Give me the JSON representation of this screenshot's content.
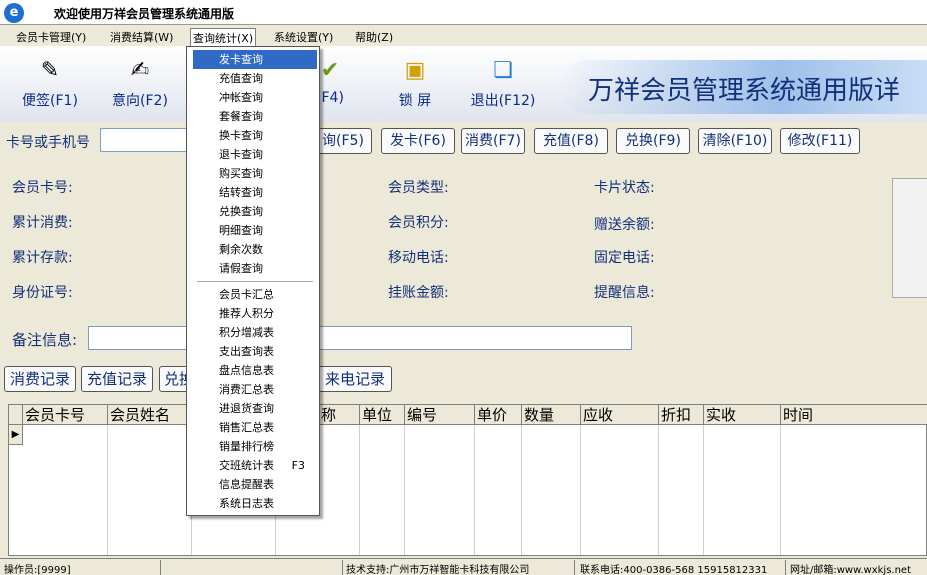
{
  "window": {
    "title": "欢迎使用万祥会员管理系统通用版",
    "icon": "app-logo-icon"
  },
  "menu": [
    {
      "label": "会员卡管理(Y)"
    },
    {
      "label": "消费结算(W)"
    },
    {
      "label": "查询统计(X)"
    },
    {
      "label": "系统设置(Y)"
    },
    {
      "label": "帮助(Z)"
    }
  ],
  "toolbar": {
    "buttons": [
      {
        "label": "便签(F1)",
        "icon": "note-icon"
      },
      {
        "label": "意向(F2)",
        "icon": "intent-icon"
      },
      {
        "label": "(F4)",
        "icon": "book-icon"
      },
      {
        "label": "锁  屏",
        "icon": "lock-screen-icon"
      },
      {
        "label": "退出(F12)",
        "icon": "exit-icon"
      }
    ],
    "banner": "万祥会员管理系统通用版详"
  },
  "search": {
    "label": "卡号或手机号",
    "value": "",
    "buttons": [
      "询(F5)",
      "发卡(F6)",
      "消费(F7)",
      "充值(F8)",
      "兑换(F9)",
      "清除(F10)",
      "修改(F11)"
    ]
  },
  "member_info": {
    "card_no": "会员卡号:",
    "total_spent": "累计消费:",
    "total_deposit": "累计存款:",
    "id_no": "身份证号:",
    "member_type": "会员类型:",
    "points": "会员积分:",
    "mobile": "移动电话:",
    "credit": "挂账金额:",
    "card_status": "卡片状态:",
    "bonus_balance": "赠送余额:",
    "phone": "固定电话:",
    "reminder": "提醒信息:"
  },
  "remark": {
    "label": "备注信息:",
    "value": ""
  },
  "tabs": [
    "消费记录",
    "充值记录",
    "兑换",
    "来电记录"
  ],
  "grid": {
    "columns": [
      "会员卡号",
      "会员姓名",
      "名称",
      "单位",
      "编号",
      "单价",
      "数量",
      "应收",
      "折扣",
      "实收",
      "时间"
    ],
    "row_indicator": "▶"
  },
  "status": {
    "operator": "操作员:[9999]",
    "support": "技术支持:广州市万祥智能卡科技有限公司",
    "contact": "联系电话:400-0386-568 15915812331",
    "website": "网址/邮箱:www.wxkjs.net"
  },
  "query_menu": {
    "items": [
      {
        "label": "发卡查询",
        "highlighted": true
      },
      {
        "label": "充值查询"
      },
      {
        "label": "冲帐查询"
      },
      {
        "label": "套餐查询"
      },
      {
        "label": "换卡查询"
      },
      {
        "label": "退卡查询"
      },
      {
        "label": "购买查询"
      },
      {
        "label": "结转查询"
      },
      {
        "label": "兑换查询"
      },
      {
        "label": "明细查询"
      },
      {
        "label": "剩余次数"
      },
      {
        "label": "请假查询"
      }
    ],
    "items2": [
      {
        "label": "会员卡汇总"
      },
      {
        "label": "推荐人积分"
      },
      {
        "label": "积分增减表"
      },
      {
        "label": "支出查询表"
      },
      {
        "label": "盘点信息表"
      },
      {
        "label": "消费汇总表"
      },
      {
        "label": "进退货查询"
      },
      {
        "label": "销售汇总表"
      },
      {
        "label": "销量排行榜"
      },
      {
        "label": "交班统计表",
        "shortcut": "F3"
      },
      {
        "label": "信息提醒表"
      },
      {
        "label": "系统日志表"
      }
    ]
  },
  "colors": {
    "accent": "#316ac5",
    "label_text": "#13307a"
  }
}
